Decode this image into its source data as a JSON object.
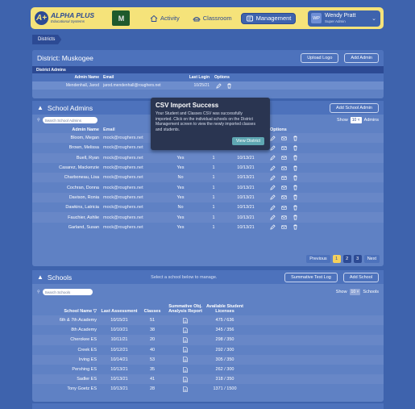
{
  "brand": {
    "name": "ALPHA PLUS",
    "tagline": "Educational Systems",
    "badge": "A+",
    "school_mark": "M"
  },
  "nav": [
    {
      "label": "Activity",
      "icon": "home-icon"
    },
    {
      "label": "Classroom",
      "icon": "classroom-icon"
    },
    {
      "label": "Management",
      "icon": "management-icon"
    }
  ],
  "user": {
    "initials": "WP",
    "name": "Wendy Pratt",
    "role": "Super Admin"
  },
  "breadcrumb": "Districts",
  "district": {
    "title": "District: Muskogee",
    "upload_logo": "Upload Logo",
    "add_admin": "Add Admin",
    "section": "District Admins",
    "columns": [
      "Admin Name",
      "Email",
      "Last Login",
      "Options"
    ],
    "row": {
      "name": "Mendenhall, Jarod",
      "email": "jarod.mendenhall@roughers.net",
      "last_login": "10/25/21"
    }
  },
  "admins": {
    "title": "School Admins",
    "add_button": "Add School Admin",
    "search_placeholder": "Search School Admins",
    "show_label": "Show",
    "show_value": "10",
    "show_suffix": "Admins",
    "columns": {
      "name": "Admin Name",
      "email": "Email",
      "status": "",
      "count": "",
      "login": "",
      "options": "Options"
    },
    "rows": [
      {
        "name": "Bloom, Megan",
        "email": "mock@roughers.net",
        "status": "Yes",
        "count": "1",
        "login": "10/13/21"
      },
      {
        "name": "Brown, Melissa",
        "email": "mock@roughers.net",
        "status": "Yes",
        "count": "1",
        "login": "10/13/21"
      },
      {
        "name": "Buell, Ryan",
        "email": "mock@roughers.net",
        "status": "Yes",
        "count": "1",
        "login": "10/13/21"
      },
      {
        "name": "Casarez, Mackenzie",
        "email": "mock@roughers.net",
        "status": "Yes",
        "count": "1",
        "login": "10/13/21"
      },
      {
        "name": "Charboneau, Lisa",
        "email": "mock@roughers.net",
        "status": "No",
        "count": "1",
        "login": "10/13/21"
      },
      {
        "name": "Cochran, Donna",
        "email": "mock@roughers.net",
        "status": "Yes",
        "count": "1",
        "login": "10/13/21"
      },
      {
        "name": "Davison, Ronia",
        "email": "mock@roughers.net",
        "status": "Yes",
        "count": "1",
        "login": "10/13/21"
      },
      {
        "name": "Dawkins, Latricia",
        "email": "mock@roughers.net",
        "status": "No",
        "count": "1",
        "login": "10/13/21"
      },
      {
        "name": "Fauchier, Ashlie",
        "email": "mock@roughers.net",
        "status": "Yes",
        "count": "1",
        "login": "10/13/21"
      },
      {
        "name": "Garland, Susan",
        "email": "mock@roughers.net",
        "status": "Yes",
        "count": "1",
        "login": "10/13/21"
      }
    ],
    "pager": {
      "prev": "Previous",
      "pages": [
        "1",
        "2",
        "3"
      ],
      "next": "Next"
    }
  },
  "toast": {
    "title": "CSV Import Success",
    "body": "Your Student and Classes CSV was successfully imported. Click on the individual schools on the District Management screen to view the newly imported classes and students.",
    "button": "View District"
  },
  "schools": {
    "title": "Schools",
    "hint": "Select a school below to manage.",
    "test_log": "Summative Test Log",
    "add_school": "Add School",
    "search_placeholder": "Search Schools",
    "show_label": "Show",
    "show_value": "10",
    "show_suffix": "Schools",
    "columns": {
      "name": "School Name",
      "last": "Last Assessment",
      "classes": "Classes",
      "report": "Summative Obj. Analysis Report",
      "licenses": "Available Student Licenses"
    },
    "rows": [
      {
        "name": "6th & 7th Academy",
        "last": "10/15/21",
        "classes": "51",
        "licenses": "475 / 636"
      },
      {
        "name": "8th Academy",
        "last": "10/10/21",
        "classes": "38",
        "licenses": "345 / 356"
      },
      {
        "name": "Cherokee ES",
        "last": "10/11/21",
        "classes": "20",
        "licenses": "298 / 350"
      },
      {
        "name": "Creek ES",
        "last": "10/12/21",
        "classes": "40",
        "licenses": "292 / 300"
      },
      {
        "name": "Irving ES",
        "last": "10/14/21",
        "classes": "53",
        "licenses": "305 / 350"
      },
      {
        "name": "Pershing ES",
        "last": "10/13/21",
        "classes": "35",
        "licenses": "262 / 300"
      },
      {
        "name": "Sadler ES",
        "last": "10/13/21",
        "classes": "41",
        "licenses": "318 / 350"
      },
      {
        "name": "Tony Goetz ES",
        "last": "10/13/21",
        "classes": "28",
        "licenses": "1371 / 1500"
      }
    ]
  },
  "colors": {
    "background": "#3e63ad",
    "topbar": "#f5e37a",
    "panel": "#5f81c4",
    "toast": "#2a3551",
    "accent": "#f5d15c"
  }
}
